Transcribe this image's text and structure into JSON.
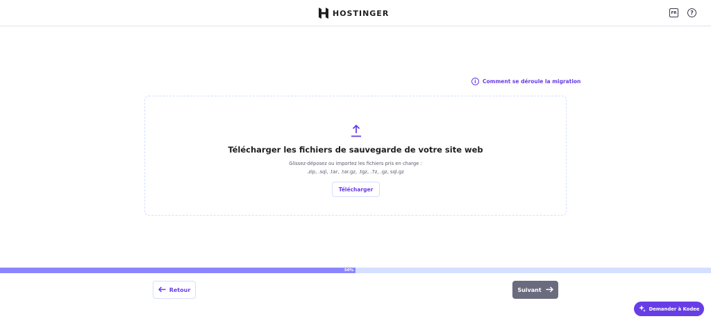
{
  "header": {
    "logo_text": "HOSTINGER",
    "lang_label": "FR",
    "help_symbol": "?"
  },
  "migration_link": {
    "label": "Comment se déroule la migration",
    "icon": "info-icon"
  },
  "dropzone": {
    "icon": "upload-icon",
    "title": "Télécharger les fichiers de sauvegarde de votre site web",
    "subtitle": "Glissez-déposez ou importez les fichiers pris en charge :",
    "formats": ".zip, .sql, .tar, .tar.gz, .tgz, .7z, .gz, sql.gz",
    "button_label": "Télécharger"
  },
  "progress": {
    "label": "50%",
    "value": 0.5
  },
  "footer": {
    "back_label": "Retour",
    "next_label": "Suivant",
    "kodee_label": "Demander à Kodee"
  },
  "colors": {
    "accent": "#673de6",
    "progress_fill": "#8c85ff",
    "progress_track": "#d5dfff",
    "next_disabled": "#6b6b7e"
  }
}
